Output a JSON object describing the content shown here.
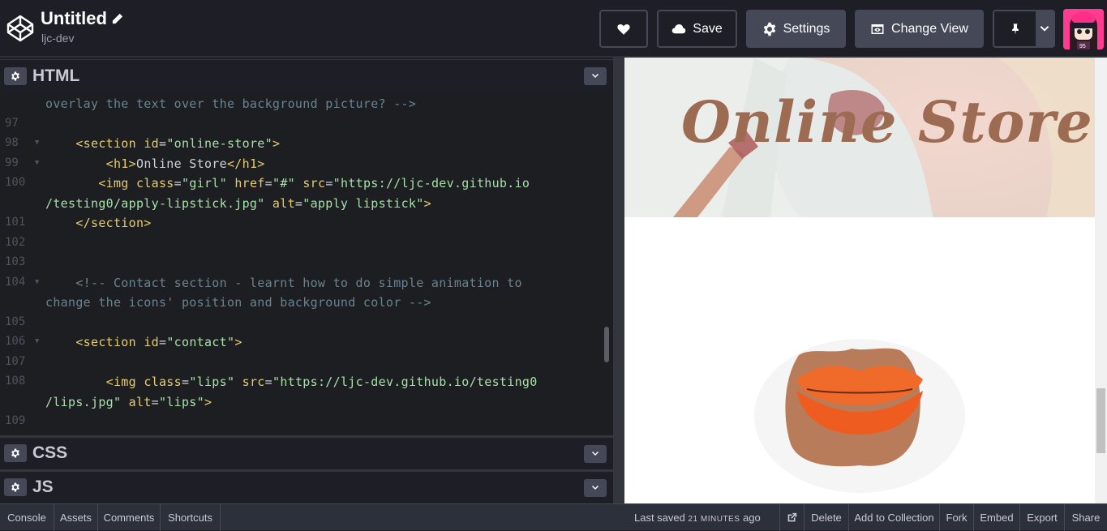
{
  "header": {
    "title": "Untitled",
    "username": "ljc-dev",
    "save_label": "Save",
    "settings_label": "Settings",
    "change_view_label": "Change View",
    "avatar_badge": "95"
  },
  "editor": {
    "html_title": "HTML",
    "css_title": "CSS",
    "js_title": "JS",
    "lines": [
      {
        "num": "",
        "fold": false,
        "wrap": true,
        "parts": [
          {
            "t": "overlay the text over the background picture? -->",
            "c": "c-comment"
          }
        ]
      },
      {
        "num": "97",
        "fold": false,
        "parts": []
      },
      {
        "num": "98",
        "fold": true,
        "parts": [
          {
            "t": "    <section ",
            "c": "c-tag"
          },
          {
            "t": "id",
            "c": "c-attr"
          },
          {
            "t": "=",
            "c": "c-punc"
          },
          {
            "t": "\"online-store\"",
            "c": "c-val"
          },
          {
            "t": ">",
            "c": "c-tag"
          }
        ]
      },
      {
        "num": "99",
        "fold": true,
        "parts": [
          {
            "t": "        <h1>",
            "c": "c-tag"
          },
          {
            "t": "Online Store",
            "c": "c-punc"
          },
          {
            "t": "</h1>",
            "c": "c-tag"
          }
        ]
      },
      {
        "num": "100",
        "fold": false,
        "parts": [
          {
            "t": "       <img ",
            "c": "c-tag"
          },
          {
            "t": "class",
            "c": "c-attr"
          },
          {
            "t": "=",
            "c": "c-punc"
          },
          {
            "t": "\"girl\"",
            "c": "c-val"
          },
          {
            "t": " href",
            "c": "c-attr"
          },
          {
            "t": "=",
            "c": "c-punc"
          },
          {
            "t": "\"#\"",
            "c": "c-val"
          },
          {
            "t": " src",
            "c": "c-attr"
          },
          {
            "t": "=",
            "c": "c-punc"
          },
          {
            "t": "\"https://ljc-dev.github.io",
            "c": "c-val"
          }
        ]
      },
      {
        "num": "",
        "fold": false,
        "wrap": true,
        "parts": [
          {
            "t": "/testing0/apply-lipstick.jpg\"",
            "c": "c-val"
          },
          {
            "t": " alt",
            "c": "c-attr"
          },
          {
            "t": "=",
            "c": "c-punc"
          },
          {
            "t": "\"apply lipstick\"",
            "c": "c-val"
          },
          {
            "t": ">",
            "c": "c-tag"
          }
        ]
      },
      {
        "num": "101",
        "fold": false,
        "parts": [
          {
            "t": "    </section>",
            "c": "c-tag"
          }
        ]
      },
      {
        "num": "102",
        "fold": false,
        "parts": []
      },
      {
        "num": "103",
        "fold": false,
        "parts": []
      },
      {
        "num": "104",
        "fold": true,
        "parts": [
          {
            "t": "    <!-- Contact section - learnt how to do simple animation to",
            "c": "c-comment"
          }
        ]
      },
      {
        "num": "",
        "fold": false,
        "wrap": true,
        "parts": [
          {
            "t": "change the icons' position and background color -->",
            "c": "c-comment"
          }
        ]
      },
      {
        "num": "105",
        "fold": false,
        "parts": []
      },
      {
        "num": "106",
        "fold": true,
        "parts": [
          {
            "t": "    <section ",
            "c": "c-tag"
          },
          {
            "t": "id",
            "c": "c-attr"
          },
          {
            "t": "=",
            "c": "c-punc"
          },
          {
            "t": "\"contact\"",
            "c": "c-val"
          },
          {
            "t": ">",
            "c": "c-tag"
          }
        ]
      },
      {
        "num": "107",
        "fold": false,
        "parts": []
      },
      {
        "num": "108",
        "fold": false,
        "parts": [
          {
            "t": "        <img ",
            "c": "c-tag"
          },
          {
            "t": "class",
            "c": "c-attr"
          },
          {
            "t": "=",
            "c": "c-punc"
          },
          {
            "t": "\"lips\"",
            "c": "c-val"
          },
          {
            "t": " src",
            "c": "c-attr"
          },
          {
            "t": "=",
            "c": "c-punc"
          },
          {
            "t": "\"https://ljc-dev.github.io/testing0",
            "c": "c-val"
          }
        ]
      },
      {
        "num": "",
        "fold": false,
        "wrap": true,
        "parts": [
          {
            "t": "/lips.jpg\"",
            "c": "c-val"
          },
          {
            "t": " alt",
            "c": "c-attr"
          },
          {
            "t": "=",
            "c": "c-punc"
          },
          {
            "t": "\"lips\"",
            "c": "c-val"
          },
          {
            "t": ">",
            "c": "c-tag"
          }
        ]
      },
      {
        "num": "109",
        "fold": false,
        "parts": []
      }
    ]
  },
  "preview": {
    "store_title": "Online Store"
  },
  "footer": {
    "console": "Console",
    "assets": "Assets",
    "comments": "Comments",
    "shortcuts": "Shortcuts",
    "last_saved_prefix": "Last saved",
    "last_saved_time": "21 MINUTES",
    "last_saved_suffix": "ago",
    "delete": "Delete",
    "add_to_collection": "Add to Collection",
    "fork": "Fork",
    "embed": "Embed",
    "export": "Export",
    "share": "Share"
  },
  "colors": {
    "bg": "#1e1f26",
    "button": "#444857",
    "accent_title": "#9d6a52",
    "lipstick": "#f06a2a"
  }
}
